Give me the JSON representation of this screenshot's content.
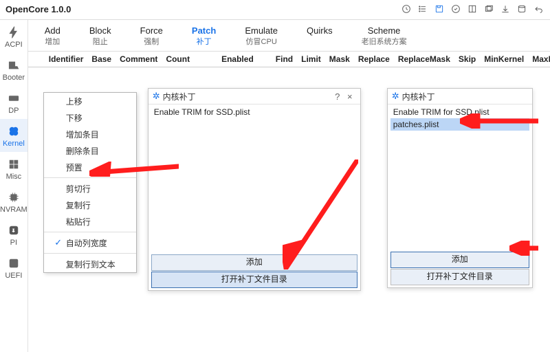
{
  "app": {
    "title": "OpenCore 1.0.0"
  },
  "sidebar": {
    "items": [
      {
        "label": "ACPI"
      },
      {
        "label": "Booter"
      },
      {
        "label": "DP"
      },
      {
        "label": "Kernel"
      },
      {
        "label": "Misc"
      },
      {
        "label": "NVRAM"
      },
      {
        "label": "PI"
      },
      {
        "label": "UEFI"
      }
    ]
  },
  "tabs": [
    {
      "en": "Add",
      "cn": "增加"
    },
    {
      "en": "Block",
      "cn": "阻止"
    },
    {
      "en": "Force",
      "cn": "强制"
    },
    {
      "en": "Patch",
      "cn": "补丁"
    },
    {
      "en": "Emulate",
      "cn": "仿冒CPU"
    },
    {
      "en": "Quirks",
      "cn": ""
    },
    {
      "en": "Scheme",
      "cn": "老旧系统方案"
    }
  ],
  "columns": [
    "Identifier",
    "Base",
    "Comment",
    "Count",
    "Enabled",
    "Find",
    "Limit",
    "Mask",
    "Replace",
    "ReplaceMask",
    "Skip",
    "MinKernel",
    "MaxKer"
  ],
  "ctx": {
    "items": [
      {
        "label": "上移"
      },
      {
        "label": "下移"
      },
      {
        "label": "增加条目"
      },
      {
        "label": "删除条目"
      },
      {
        "label": "预置"
      },
      {
        "sep": true
      },
      {
        "label": "剪切行"
      },
      {
        "label": "复制行"
      },
      {
        "label": "粘贴行"
      },
      {
        "sep": true
      },
      {
        "label": "自动列宽度",
        "checked": true
      },
      {
        "sep": true
      },
      {
        "label": "复制行到文本"
      }
    ]
  },
  "dlg1": {
    "title": "内核补丁",
    "items": [
      "Enable TRIM for SSD.plist"
    ],
    "add": "添加",
    "open": "打开补丁文件目录"
  },
  "dlg2": {
    "title": "内核补丁",
    "items": [
      "Enable TRIM for SSD.plist",
      "patches.plist"
    ],
    "selectedIndex": 1,
    "add": "添加",
    "open": "打开补丁文件目录"
  },
  "glyphs": {
    "check": "✓",
    "gear": "✲",
    "help": "?",
    "close": "×"
  }
}
